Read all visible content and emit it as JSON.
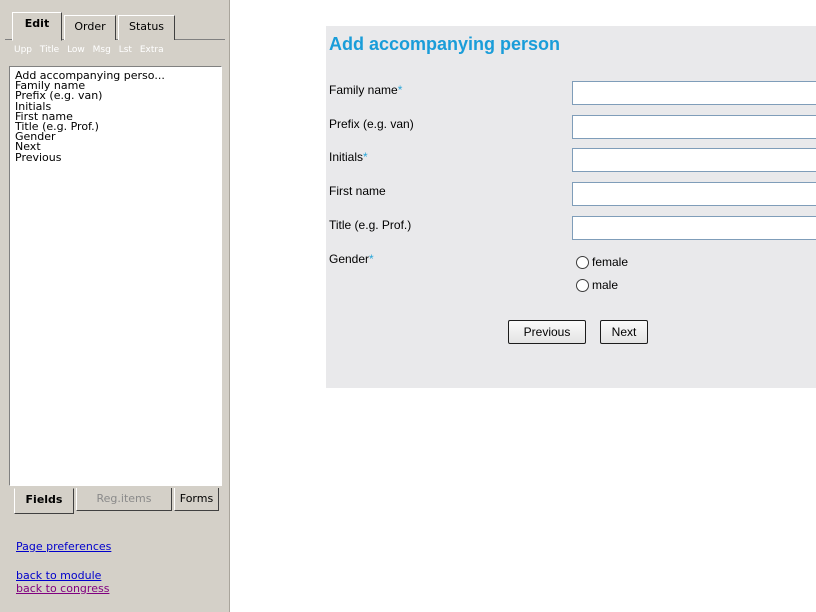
{
  "sidebar": {
    "top_tabs": [
      "Edit",
      "Order",
      "Status"
    ],
    "toolbar": [
      "Upp",
      "Title",
      "Low",
      "Msg",
      "Lst",
      "Extra"
    ],
    "fields": [
      "Add accompanying perso...",
      "Family name",
      "Prefix (e.g. van)",
      "Initials",
      "First name",
      "Title (e.g. Prof.)",
      "Gender",
      "Next",
      "Previous"
    ],
    "bottom_tabs": [
      "Fields",
      "Reg.items",
      "Forms"
    ],
    "links": {
      "page_preferences": "Page preferences",
      "back_to_module": "back to module",
      "back_to_congress": "back to congress"
    }
  },
  "form": {
    "title": "Add accompanying person",
    "required_marker": "*",
    "fields": [
      {
        "label": "Family name",
        "value": ""
      },
      {
        "label": "Prefix (e.g. van)",
        "value": ""
      },
      {
        "label": "Initials",
        "value": ""
      },
      {
        "label": "First name",
        "value": ""
      },
      {
        "label": "Title (e.g. Prof.)",
        "value": ""
      }
    ],
    "gender": {
      "label": "Gender",
      "options": [
        "female",
        "male"
      ]
    },
    "buttons": {
      "previous": "Previous",
      "next": "Next"
    }
  },
  "colors": {
    "title": "#1a9dd9",
    "required": "#2aa6d9",
    "panel_bg": "#e9e9eb",
    "sidebar_bg": "#d4d0c8",
    "link": "#0000cc",
    "visited_link": "#800080"
  }
}
